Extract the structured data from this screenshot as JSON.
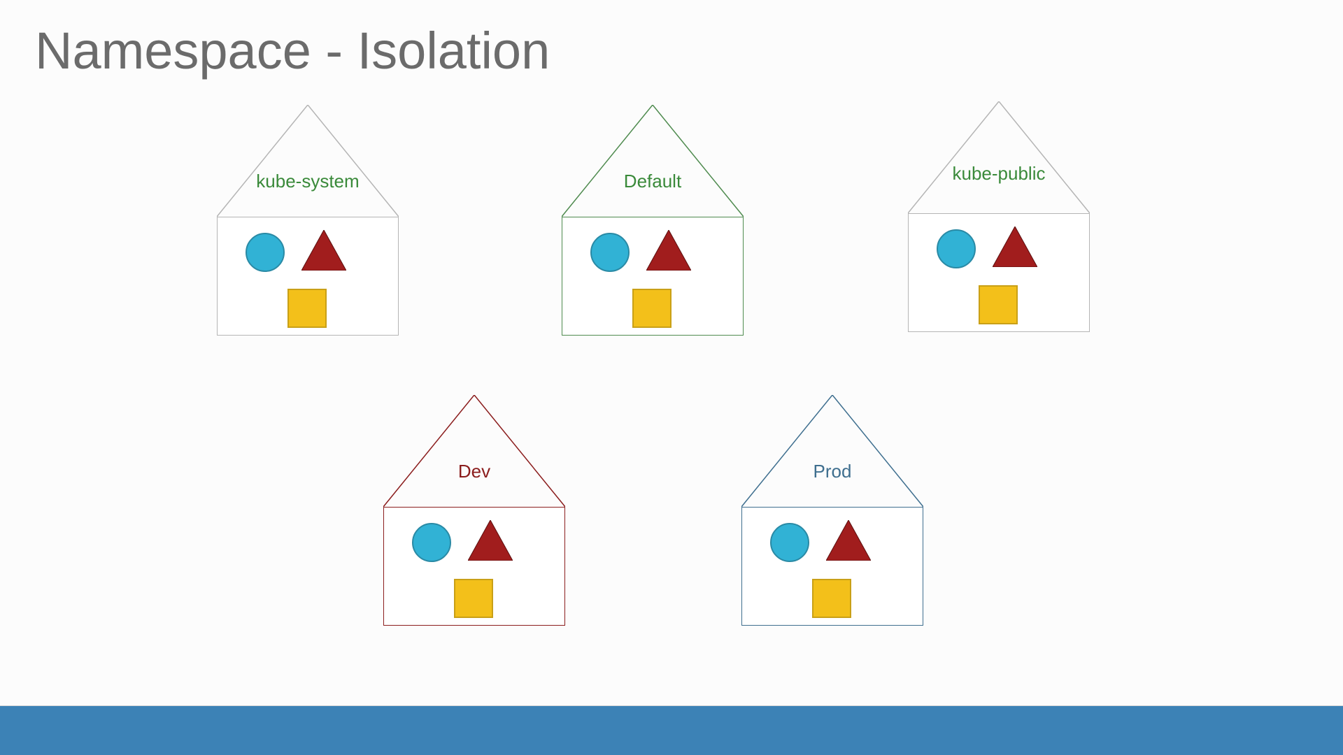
{
  "title": "Namespace - Isolation",
  "houses": {
    "kube_system": {
      "label": "kube-system",
      "label_color": "#3a8a3a",
      "outline": "#b5b5b5"
    },
    "default": {
      "label": "Default",
      "label_color": "#3a8a3a",
      "outline": "#4f8b4f"
    },
    "kube_public": {
      "label": "kube-public",
      "label_color": "#3a8a3a",
      "outline": "#b5b5b5"
    },
    "dev": {
      "label": "Dev",
      "label_color": "#8b1d1d",
      "outline": "#8b1d1d"
    },
    "prod": {
      "label": "Prod",
      "label_color": "#3f6f8f",
      "outline": "#3f6f8f"
    }
  },
  "colors": {
    "circle_fill": "#31b2d5",
    "circle_stroke": "#2a8aa5",
    "triangle_fill": "#a11d1d",
    "triangle_stroke": "#5b0f0f",
    "square_fill": "#f3c01a",
    "square_stroke": "#c9a017",
    "footer": "#3c82b6",
    "title_color": "#6b6b6b"
  }
}
